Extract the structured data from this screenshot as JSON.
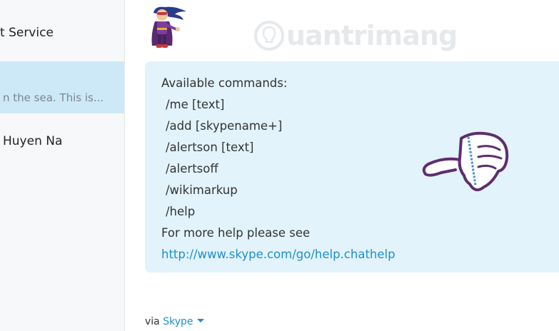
{
  "sidebar": {
    "contacts": [
      {
        "name": "t Service"
      },
      {
        "preview": "n the sea. This is..."
      },
      {
        "name": "Huyen Na"
      }
    ]
  },
  "watermark": {
    "text": "uantrimang"
  },
  "message": {
    "heading": "Available commands:",
    "commands": [
      "/me [text]",
      "/add [skypename+]",
      "/alertson [text]",
      "/alertsoff",
      "/wikimarkup",
      "/help"
    ],
    "more_help": "For more help please see",
    "link": "http://www.skype.com/go/help.chathelp"
  },
  "footer": {
    "via_label": "via",
    "via_app": "Skype"
  },
  "icons": [
    "superhero-avatar-icon",
    "thumbs-down-emoticon-icon",
    "dropdown-caret-icon"
  ],
  "colors": {
    "selected_bg": "#cde9f7",
    "bubble_bg": "#e2f3fb",
    "link": "#1f8fce"
  }
}
